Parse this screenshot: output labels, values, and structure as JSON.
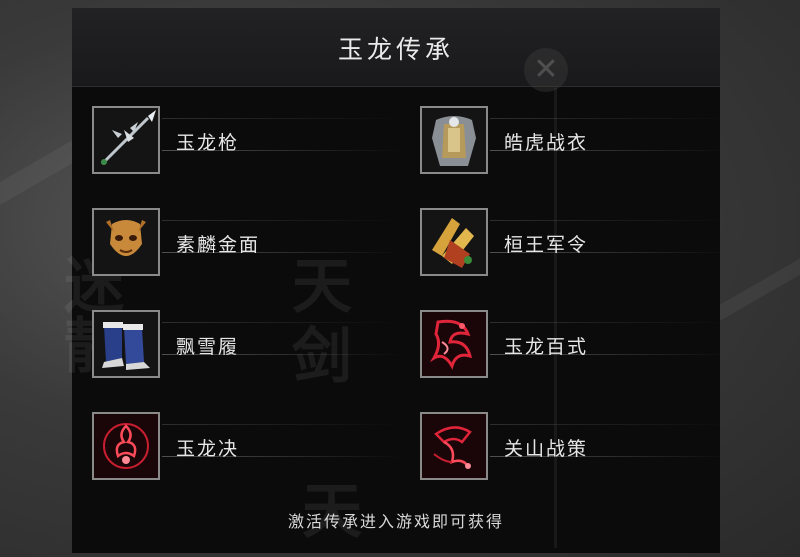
{
  "dialog": {
    "title": "玉龙传承",
    "footer_hint": "激活传承进入游戏即可获得"
  },
  "items": [
    {
      "label": "玉龙枪",
      "icon": "spear-icon"
    },
    {
      "label": "皓虎战衣",
      "icon": "armor-icon"
    },
    {
      "label": "素麟金面",
      "icon": "golden-mask-icon"
    },
    {
      "label": "桓王军令",
      "icon": "military-order-icon"
    },
    {
      "label": "飘雪履",
      "icon": "boots-icon"
    },
    {
      "label": "玉龙百式",
      "icon": "dragon-art-icon"
    },
    {
      "label": "玉龙决",
      "icon": "dragon-skill-icon"
    },
    {
      "label": "关山战策",
      "icon": "war-strategy-icon"
    }
  ],
  "colors": {
    "panel_bg": "#0b0b0c",
    "frame_border": "#8a8a8a",
    "text": "#e6e6e6",
    "red_glow": "#e0243a"
  }
}
